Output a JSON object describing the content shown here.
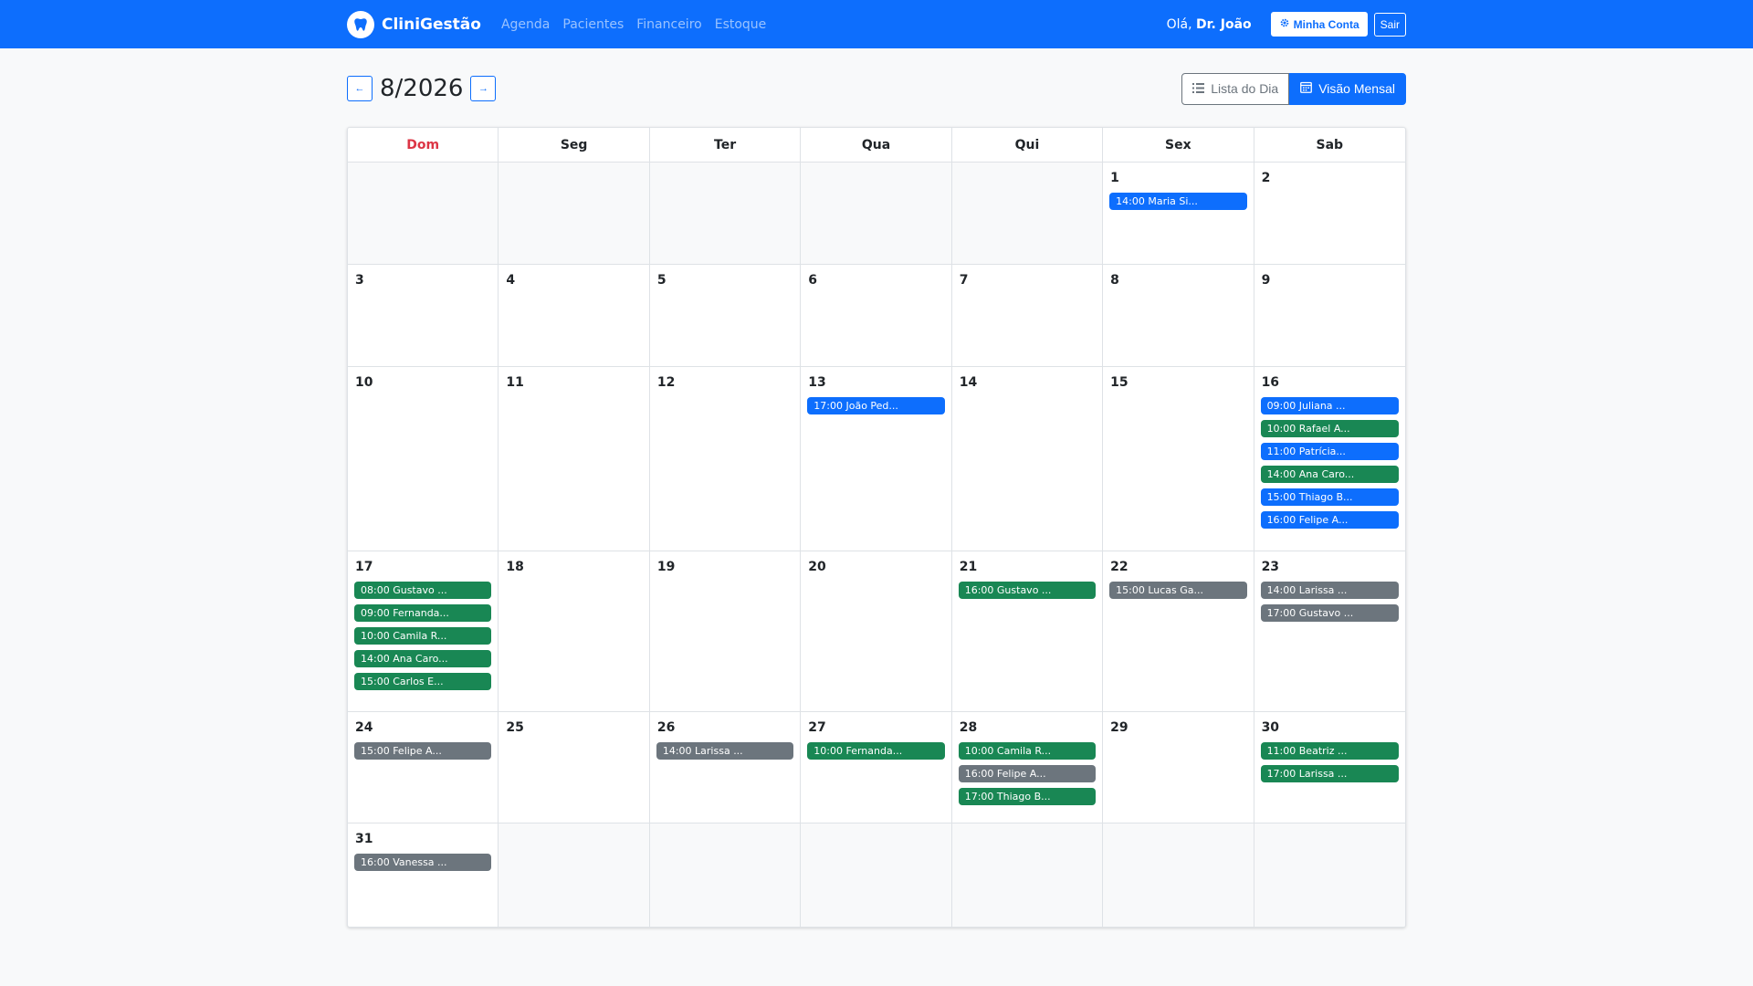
{
  "navbar": {
    "brand": "CliniGestão",
    "links": [
      "Agenda",
      "Pacientes",
      "Financeiro",
      "Estoque"
    ],
    "greeting_prefix": "Olá,",
    "user_name": "Dr. João",
    "account_label": "Minha Conta",
    "logout_label": "Sair"
  },
  "toolbar": {
    "prev_label": "←",
    "next_label": "→",
    "month_title": "8/2026",
    "list_view_label": "Lista do Dia",
    "month_view_label": "Visão Mensal",
    "active_view": "month"
  },
  "colors": {
    "primary": "#0d6efd",
    "success": "#198754",
    "secondary": "#6c757d",
    "sunday": "#dc3545"
  },
  "calendar": {
    "weekdays": [
      "Dom",
      "Seg",
      "Ter",
      "Qua",
      "Qui",
      "Sex",
      "Sab"
    ],
    "first_weekday_index": 5,
    "days_in_month": 31,
    "events": {
      "1": [
        {
          "label": "14:00 Maria Si...",
          "status": "primary"
        }
      ],
      "13": [
        {
          "label": "17:00 João Ped...",
          "status": "primary"
        }
      ],
      "16": [
        {
          "label": "09:00 Juliana ...",
          "status": "primary"
        },
        {
          "label": "10:00 Rafael A...",
          "status": "success"
        },
        {
          "label": "11:00 Patrícia...",
          "status": "primary"
        },
        {
          "label": "14:00 Ana Caro...",
          "status": "success"
        },
        {
          "label": "15:00 Thiago B...",
          "status": "primary"
        },
        {
          "label": "16:00 Felipe A...",
          "status": "primary"
        }
      ],
      "17": [
        {
          "label": "08:00 Gustavo ...",
          "status": "success"
        },
        {
          "label": "09:00 Fernanda...",
          "status": "success"
        },
        {
          "label": "10:00 Camila R...",
          "status": "success"
        },
        {
          "label": "14:00 Ana Caro...",
          "status": "success"
        },
        {
          "label": "15:00 Carlos E...",
          "status": "success"
        }
      ],
      "21": [
        {
          "label": "16:00 Gustavo ...",
          "status": "success"
        }
      ],
      "22": [
        {
          "label": "15:00 Lucas Ga...",
          "status": "secondary"
        }
      ],
      "23": [
        {
          "label": "14:00 Larissa ...",
          "status": "secondary"
        },
        {
          "label": "17:00 Gustavo ...",
          "status": "secondary"
        }
      ],
      "24": [
        {
          "label": "15:00 Felipe A...",
          "status": "secondary"
        }
      ],
      "26": [
        {
          "label": "14:00 Larissa ...",
          "status": "secondary"
        }
      ],
      "27": [
        {
          "label": "10:00 Fernanda...",
          "status": "success"
        }
      ],
      "28": [
        {
          "label": "10:00 Camila R...",
          "status": "success"
        },
        {
          "label": "16:00 Felipe A...",
          "status": "secondary"
        },
        {
          "label": "17:00 Thiago B...",
          "status": "success"
        }
      ],
      "30": [
        {
          "label": "11:00 Beatriz ...",
          "status": "success"
        },
        {
          "label": "17:00 Larissa ...",
          "status": "success"
        }
      ],
      "31": [
        {
          "label": "16:00 Vanessa ...",
          "status": "secondary"
        }
      ]
    }
  }
}
